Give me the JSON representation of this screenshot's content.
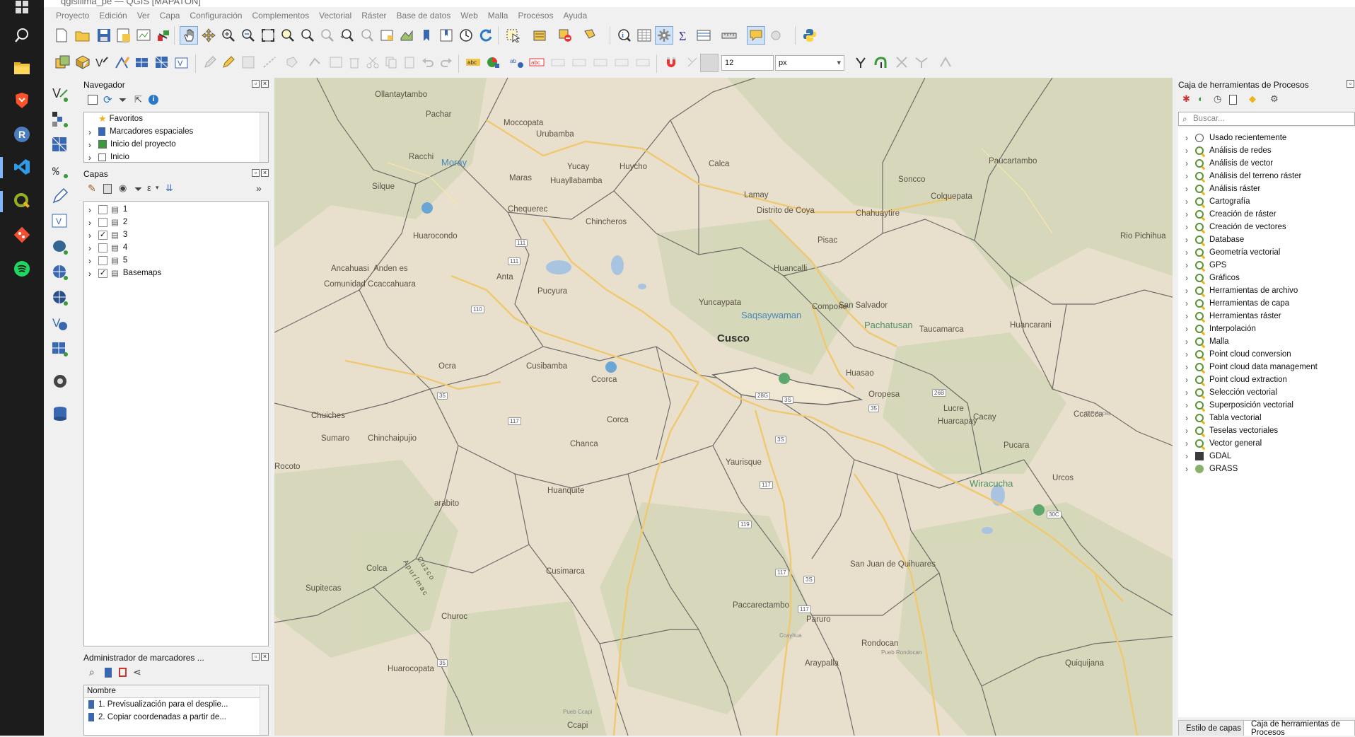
{
  "window": {
    "title": "qgisilima_pe — QGIS [MAPATON]"
  },
  "menu": [
    "Proyecto",
    "Edición",
    "Ver",
    "Capa",
    "Configuración",
    "Complementos",
    "Vectorial",
    "Ráster",
    "Base de datos",
    "Web",
    "Malla",
    "Procesos",
    "Ayuda"
  ],
  "toolbar": {
    "font_size_value": "12",
    "unit_value": "px"
  },
  "navigator": {
    "title": "Navegador",
    "items": [
      "Favoritos",
      "Marcadores espaciales",
      "Inicio del proyecto",
      "Inicio"
    ]
  },
  "layers": {
    "title": "Capas",
    "items": [
      {
        "name": "1",
        "checked": false
      },
      {
        "name": "2",
        "checked": false
      },
      {
        "name": "3",
        "checked": true
      },
      {
        "name": "4",
        "checked": false
      },
      {
        "name": "5",
        "checked": false
      },
      {
        "name": "Basemaps",
        "checked": true
      }
    ]
  },
  "bookmarks": {
    "title": "Administrador de marcadores ...",
    "column": "Nombre",
    "items": [
      "1. Previsualización para el desplie...",
      "2. Copiar coordenadas a partir de..."
    ]
  },
  "map": {
    "labels": [
      "Ollantaytambo",
      "Pachar",
      "Moccopata",
      "Urubamba",
      "Calca",
      "Paucartambo",
      "Racchi",
      "Moray",
      "Maras",
      "Yucay",
      "Huayllabamba",
      "Huycho",
      "Soncco",
      "Silque",
      "Lamay",
      "Colquepata",
      "Chequerec",
      "Chincheros",
      "Distrito de Coya",
      "Chahuaytire",
      "Huarocondo",
      "Pisac",
      "Rio Pichihua",
      "Ancahuasi",
      "Anden es",
      "Anta",
      "Huancalli",
      "Comunidad Ccaccahuara",
      "Pucyura",
      "Yuncaypata",
      "San Salvador",
      "Compone",
      "Saqsaywaman",
      "Pachatusan",
      "Taucamarca",
      "Huancarani",
      "Cusco",
      "Ocra",
      "Cusibamba",
      "Huasao",
      "Ccorca",
      "Oropesa",
      "Lucre",
      "Huarcapay",
      "Cacay",
      "Ccatcca",
      "Chuiches",
      "Corca",
      "Sumaro",
      "Chinchaipujio",
      "Chanca",
      "Pucara",
      "Huanquite",
      "Wiracucha",
      "Urcos",
      "Rocoto",
      "Yaurisque",
      "arabito",
      "Colca",
      "Cusimarca",
      "San Juan de Quihuares",
      "Supitecas",
      "Churoc",
      "Paccarectambo",
      "Paruro",
      "Rondocan",
      "Huarocopata",
      "Araypalla",
      "Quiquijana",
      "C P Accas",
      "Cuzco",
      "Apurímac",
      "Ccapi",
      "Pueb Ccapi",
      "Pueb Rondocan",
      "Ccayhua"
    ],
    "road_numbers": [
      "111",
      "110",
      "111",
      "35",
      "117",
      "3S",
      "35",
      "35",
      "3S",
      "30C",
      "117",
      "119",
      "117",
      "3S",
      "117",
      "28G",
      "26B"
    ]
  },
  "processing": {
    "title": "Caja de herramientas de Procesos",
    "search_placeholder": "Buscar...",
    "items": [
      "Usado recientemente",
      "Análisis de redes",
      "Análisis de vector",
      "Análisis del terreno ráster",
      "Análisis ráster",
      "Cartografía",
      "Creación de ráster",
      "Creación de vectores",
      "Database",
      "Geometría vectorial",
      "GPS",
      "Gráficos",
      "Herramientas de archivo",
      "Herramientas de capa",
      "Herramientas ráster",
      "Interpolación",
      "Malla",
      "Point cloud conversion",
      "Point cloud data management",
      "Point cloud extraction",
      "Selección vectorial",
      "Superposición vectorial",
      "Tabla vectorial",
      "Teselas vectoriales",
      "Vector general",
      "GDAL",
      "GRASS"
    ]
  },
  "bottom_tabs": [
    "Estilo de capas",
    "Caja de herramientas de Procesos"
  ],
  "colors": {
    "taskbar": "#1c1c1c",
    "map_bg": "#e8e0cc",
    "qgis_green": "#589632",
    "qgis_yellow": "#eeb21c",
    "road": "#f0c870",
    "border": "#5a5a5a"
  }
}
